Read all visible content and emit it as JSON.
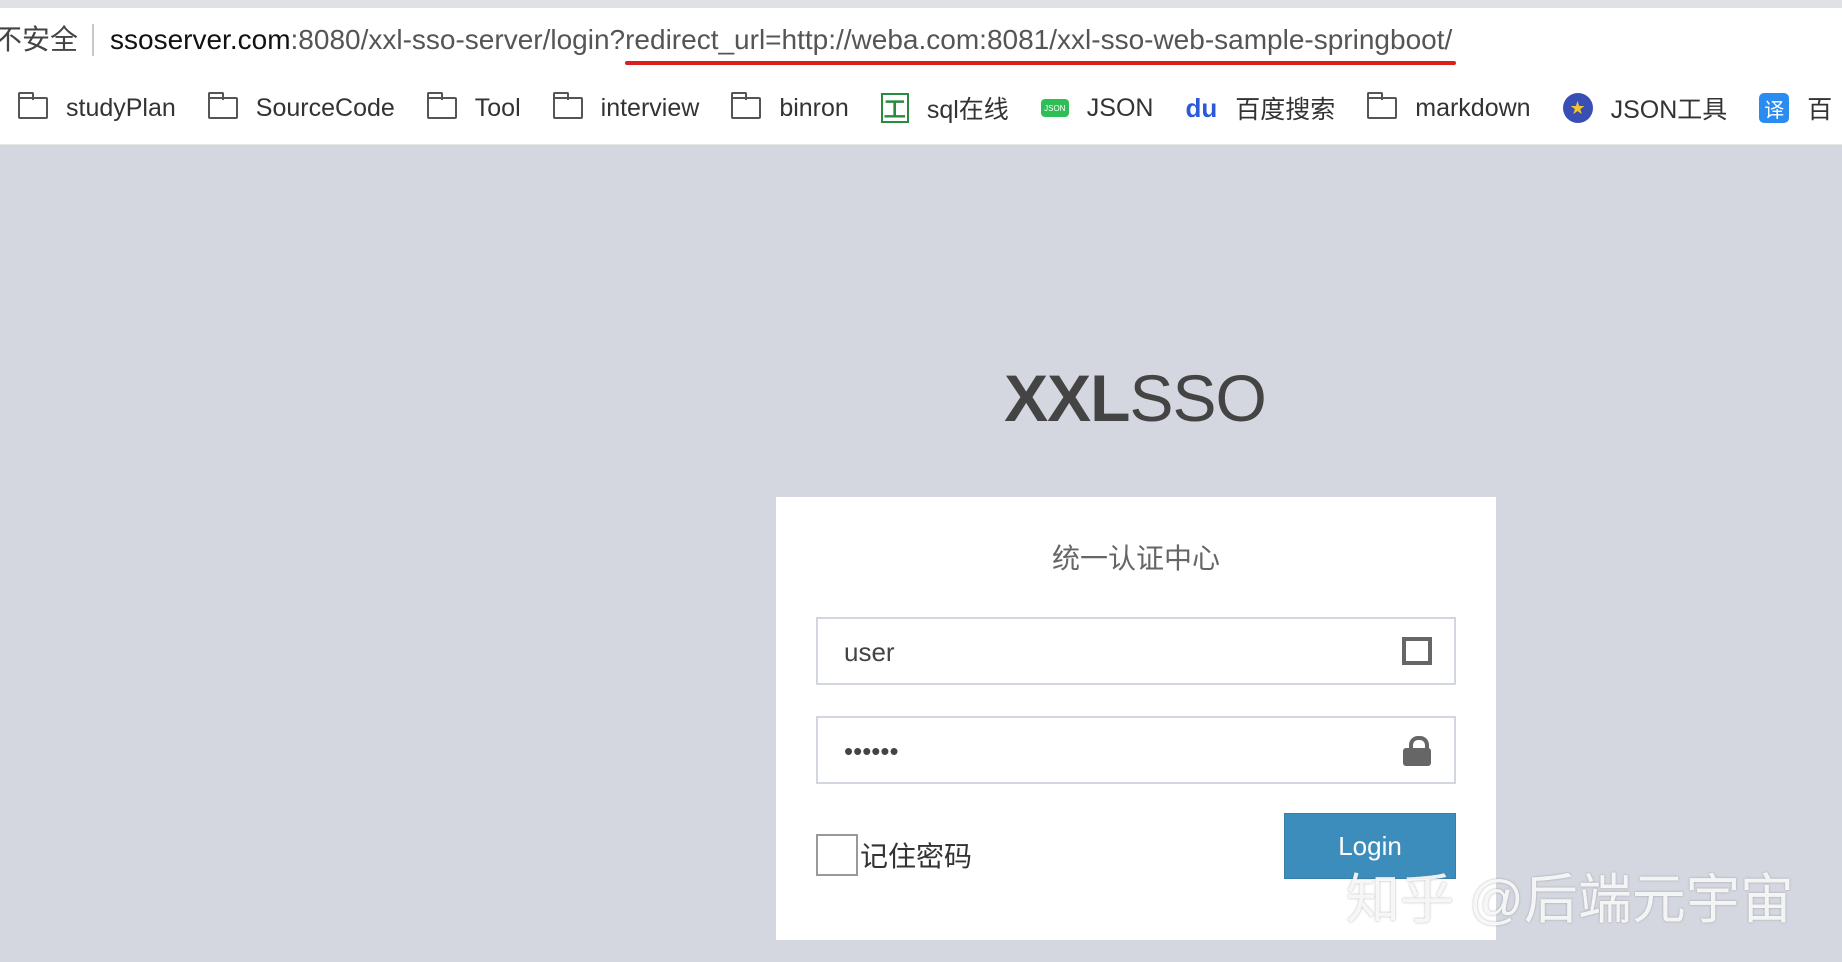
{
  "browser": {
    "security_label": "不安全",
    "url": {
      "host": "ssoserver.com",
      "path": ":8080/xxl-sso-server/login?",
      "query": "redirect_url=http://weba.com:8081/xxl-sso-web-sample-springboot/"
    },
    "bookmarks": [
      {
        "label": "studyPlan",
        "icon": "folder-icon"
      },
      {
        "label": "SourceCode",
        "icon": "folder-icon"
      },
      {
        "label": "Tool",
        "icon": "folder-icon"
      },
      {
        "label": "interview",
        "icon": "folder-icon"
      },
      {
        "label": "binron",
        "icon": "folder-icon"
      },
      {
        "label": "sql在线",
        "icon": "sql-tool-icon"
      },
      {
        "label": "JSON",
        "icon": "json-badge-icon"
      },
      {
        "label": "百度搜索",
        "icon": "baidu-paw-icon"
      },
      {
        "label": "markdown",
        "icon": "folder-icon"
      },
      {
        "label": "JSON工具",
        "icon": "json-tool-icon"
      },
      {
        "label": "百",
        "icon": "translate-icon"
      }
    ]
  },
  "login": {
    "logo_bold": "XXL",
    "logo_light": "SSO",
    "title": "统一认证中心",
    "username_value": "user",
    "password_value": "••••••",
    "remember_label": "记住密码",
    "login_label": "Login"
  },
  "watermark": "知乎 @后端元宇宙",
  "icon_glyphs": {
    "sql_tool": "工",
    "json_badge": "JSON",
    "baidu": "du",
    "translate": "译"
  },
  "colors": {
    "background": "#d4d7e0",
    "login_button": "#3c8dbc",
    "url_underline": "#d9201c"
  }
}
